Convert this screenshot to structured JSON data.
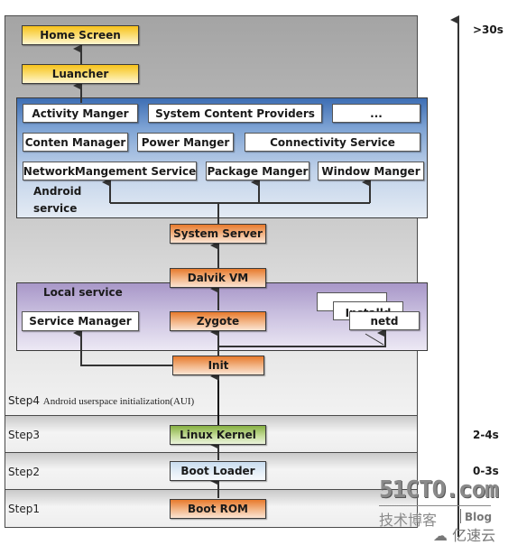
{
  "steps": [
    {
      "id": "step4",
      "label": "Step4",
      "description": "Android userspace initialization(AUI)"
    },
    {
      "id": "step3",
      "label": "Step3"
    },
    {
      "id": "step2",
      "label": "Step2"
    },
    {
      "id": "step1",
      "label": "Step1"
    }
  ],
  "timeline": {
    "labels": [
      ">30s",
      "2-4s",
      "0-3s"
    ]
  },
  "nodes": {
    "home_screen": "Home Screen",
    "launcher": "Luancher",
    "system_server": "System Server",
    "dalvik_vm": "Dalvik VM",
    "zygote": "Zygote",
    "init": "Init",
    "linux_kernel": "Linux Kernel",
    "boot_loader": "Boot Loader",
    "boot_rom": "Boot ROM"
  },
  "android_service": {
    "label": "Android service",
    "label_line1": "Android",
    "label_line2": "service",
    "row1": [
      "Activity Manger",
      "System Content Providers",
      "..."
    ],
    "row2": [
      "Conten Manager",
      "Power Manger",
      "Connectivity Service"
    ],
    "row3": [
      "NetworkMangement Service",
      "Package Manger",
      "Window Manger"
    ]
  },
  "local_service": {
    "label": "Local service",
    "service_manager": "Service Manager",
    "stack": [
      "",
      "Installd",
      "netd"
    ]
  },
  "colors": {
    "yellow": "#f7c21b",
    "orange": "#e77a2c",
    "green": "#86b042",
    "light_blue": "#c9dcef",
    "android_panel_blue": "#3d6eb4",
    "local_panel_purple": "#a897c8"
  },
  "watermark": {
    "site": "51CTO.com",
    "tagline": "技术博客",
    "blog": "Blog",
    "brand": "亿速云"
  }
}
